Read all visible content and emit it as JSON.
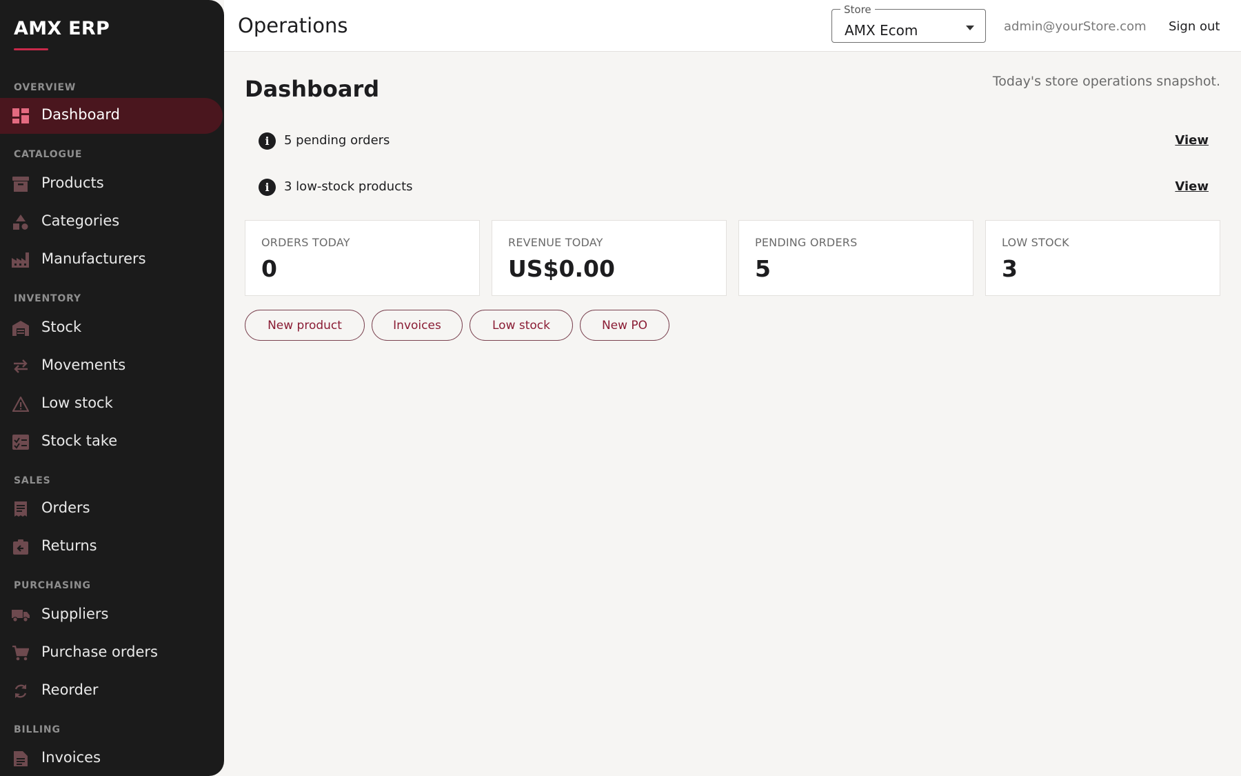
{
  "brand": {
    "name": "AMX ERP",
    "accent": "#c8294a"
  },
  "sidebar": {
    "sections": [
      {
        "label": "OVERVIEW"
      },
      {
        "label": "CATALOGUE"
      },
      {
        "label": "INVENTORY"
      },
      {
        "label": "SALES"
      },
      {
        "label": "PURCHASING"
      },
      {
        "label": "BILLING"
      }
    ],
    "items": [
      {
        "label": "Dashboard",
        "icon": "dashboard-icon",
        "active": true
      },
      {
        "label": "Products",
        "icon": "archive-box-icon"
      },
      {
        "label": "Categories",
        "icon": "shapes-icon"
      },
      {
        "label": "Manufacturers",
        "icon": "factory-icon"
      },
      {
        "label": "Stock",
        "icon": "warehouse-icon"
      },
      {
        "label": "Movements",
        "icon": "swap-arrows-icon"
      },
      {
        "label": "Low stock",
        "icon": "warning-triangle-icon"
      },
      {
        "label": "Stock take",
        "icon": "checklist-icon"
      },
      {
        "label": "Orders",
        "icon": "receipt-icon"
      },
      {
        "label": "Returns",
        "icon": "return-box-icon"
      },
      {
        "label": "Suppliers",
        "icon": "truck-icon"
      },
      {
        "label": "Purchase orders",
        "icon": "cart-icon"
      },
      {
        "label": "Reorder",
        "icon": "refresh-icon"
      },
      {
        "label": "Invoices",
        "icon": "document-icon"
      }
    ]
  },
  "topbar": {
    "title": "Operations",
    "store": {
      "legend": "Store",
      "value": "AMX Ecom"
    },
    "user_email": "admin@yourStore.com",
    "sign_out": "Sign out"
  },
  "main": {
    "title": "Dashboard",
    "subtitle": "Today's store operations snapshot.",
    "alerts": [
      {
        "text": "5 pending orders",
        "link": "View"
      },
      {
        "text": "3 low-stock products",
        "link": "View"
      }
    ],
    "kpis": [
      {
        "label": "ORDERS TODAY",
        "value": "0"
      },
      {
        "label": "REVENUE TODAY",
        "value": "US$0.00"
      },
      {
        "label": "PENDING ORDERS",
        "value": "5"
      },
      {
        "label": "LOW STOCK",
        "value": "3"
      }
    ],
    "quick_actions": [
      {
        "label": "New product"
      },
      {
        "label": "Invoices"
      },
      {
        "label": "Low stock"
      },
      {
        "label": "New PO"
      }
    ]
  },
  "colors": {
    "sidebar_bg": "#1b1b1b",
    "active_bg": "#4a161e",
    "icon_muted": "#6e4a4f",
    "icon_active": "#e36a80",
    "action_text": "#8a1c34"
  }
}
